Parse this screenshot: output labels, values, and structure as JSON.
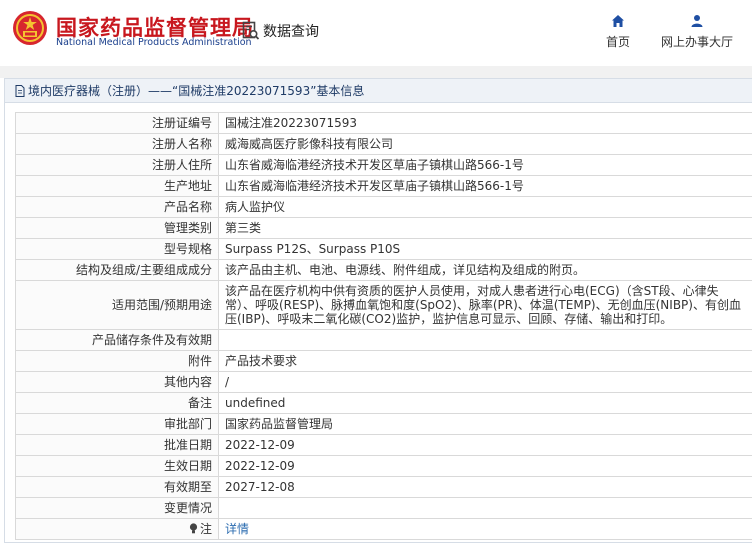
{
  "header": {
    "brand_cn": "国家药品监督管理局",
    "brand_en": "National Medical Products Administration",
    "query_label": "数据查询",
    "nav": [
      {
        "label": "首页",
        "icon": "home-icon"
      },
      {
        "label": "网上办事大厅",
        "icon": "user-icon"
      }
    ]
  },
  "colors": {
    "brand_red": "#c8171e",
    "brand_blue": "#1a3f8c",
    "link": "#2b6cb0"
  },
  "panel": {
    "title": "境内医疗器械（注册）——“国械注准20223071593”基本信息"
  },
  "rows": [
    {
      "key": "注册证编号",
      "value": "国械注准20223071593"
    },
    {
      "key": "注册人名称",
      "value": "威海威高医疗影像科技有限公司"
    },
    {
      "key": "注册人住所",
      "value": "山东省威海临港经济技术开发区草庙子镇棋山路566-1号"
    },
    {
      "key": "生产地址",
      "value": "山东省威海临港经济技术开发区草庙子镇棋山路566-1号"
    },
    {
      "key": "产品名称",
      "value": "病人监护仪"
    },
    {
      "key": "管理类别",
      "value": "第三类"
    },
    {
      "key": "型号规格",
      "value": "Surpass P12S、Surpass P10S"
    },
    {
      "key": "结构及组成/主要组成成分",
      "value": "该产品由主机、电池、电源线、附件组成，详见结构及组成的附页。"
    },
    {
      "key": "适用范围/预期用途",
      "value": "该产品在医疗机构中供有资质的医护人员使用，对成人患者进行心电(ECG)（含ST段、心律失常）、呼吸(RESP)、脉搏血氧饱和度(SpO2)、脉率(PR)、体温(TEMP)、无创血压(NIBP)、有创血压(IBP)、呼吸末二氧化碳(CO2)监护，监护信息可显示、回顾、存储、输出和打印。"
    },
    {
      "key": "产品储存条件及有效期",
      "value": ""
    },
    {
      "key": "附件",
      "value": "产品技术要求"
    },
    {
      "key": "其他内容",
      "value": "/"
    },
    {
      "key": "备注",
      "value": "undefined"
    },
    {
      "key": "审批部门",
      "value": "国家药品监督管理局"
    },
    {
      "key": "批准日期",
      "value": "2022-12-09"
    },
    {
      "key": "生效日期",
      "value": "2022-12-09"
    },
    {
      "key": "有效期至",
      "value": "2027-12-08"
    },
    {
      "key": "变更情况",
      "value": ""
    },
    {
      "key": "注",
      "value": "详情"
    }
  ]
}
